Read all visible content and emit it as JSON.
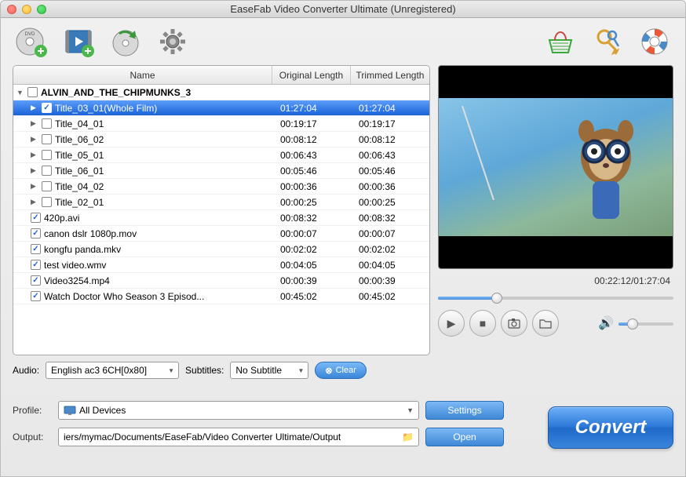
{
  "window": {
    "title": "EaseFab Video Converter Ultimate (Unregistered)"
  },
  "toolbar": {
    "icons": [
      "dvd-add",
      "video-add",
      "disc-refresh",
      "settings-gear"
    ],
    "right_icons": [
      "shop-basket",
      "register-key",
      "help-lifesaver"
    ]
  },
  "list": {
    "headers": {
      "name": "Name",
      "original": "Original Length",
      "trimmed": "Trimmed Length"
    },
    "group": {
      "name": "ALVIN_AND_THE_CHIPMUNKS_3",
      "expanded": true,
      "checked": false
    },
    "children": [
      {
        "name": "Title_03_01(Whole Film)",
        "orig": "01:27:04",
        "trim": "01:27:04",
        "checked": true,
        "selected": true
      },
      {
        "name": "Title_04_01",
        "orig": "00:19:17",
        "trim": "00:19:17",
        "checked": false
      },
      {
        "name": "Title_06_02",
        "orig": "00:08:12",
        "trim": "00:08:12",
        "checked": false
      },
      {
        "name": "Title_05_01",
        "orig": "00:06:43",
        "trim": "00:06:43",
        "checked": false
      },
      {
        "name": "Title_06_01",
        "orig": "00:05:46",
        "trim": "00:05:46",
        "checked": false
      },
      {
        "name": "Title_04_02",
        "orig": "00:00:36",
        "trim": "00:00:36",
        "checked": false
      },
      {
        "name": "Title_02_01",
        "orig": "00:00:25",
        "trim": "00:00:25",
        "checked": false
      }
    ],
    "files": [
      {
        "name": "420p.avi",
        "orig": "00:08:32",
        "trim": "00:08:32",
        "checked": true
      },
      {
        "name": "canon dslr 1080p.mov",
        "orig": "00:00:07",
        "trim": "00:00:07",
        "checked": true
      },
      {
        "name": "kongfu panda.mkv",
        "orig": "00:02:02",
        "trim": "00:02:02",
        "checked": true
      },
      {
        "name": "test video.wmv",
        "orig": "00:04:05",
        "trim": "00:04:05",
        "checked": true
      },
      {
        "name": "Video3254.mp4",
        "orig": "00:00:39",
        "trim": "00:00:39",
        "checked": true
      },
      {
        "name": "Watch Doctor Who Season 3 Episod...",
        "orig": "00:45:02",
        "trim": "00:45:02",
        "checked": true
      }
    ]
  },
  "preview": {
    "time_current": "00:22:12",
    "time_total": "01:27:04",
    "progress_pct": 25
  },
  "audio": {
    "label": "Audio:",
    "value": "English ac3 6CH[0x80]"
  },
  "subtitles": {
    "label": "Subtitles:",
    "value": "No Subtitle"
  },
  "clear_btn": "Clear",
  "profile": {
    "label": "Profile:",
    "value": "All Devices"
  },
  "output": {
    "label": "Output:",
    "value": "iers/mymac/Documents/EaseFab/Video Converter Ultimate/Output"
  },
  "buttons": {
    "settings": "Settings",
    "open": "Open",
    "convert": "Convert"
  }
}
